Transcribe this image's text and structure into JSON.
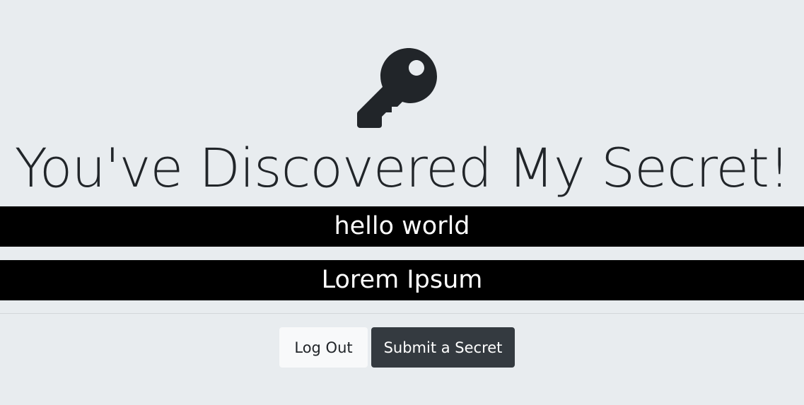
{
  "header": {
    "icon": "key-icon",
    "title": "You've Discovered My Secret!"
  },
  "secrets": [
    {
      "text": "hello world"
    },
    {
      "text": "Lorem Ipsum"
    }
  ],
  "actions": {
    "logout_label": "Log Out",
    "submit_label": "Submit a Secret"
  },
  "colors": {
    "background": "#e8ecef",
    "secret_bar": "#000000",
    "secret_text": "#ffffff",
    "button_light": "#f8f9fa",
    "button_dark": "#343a40",
    "text": "#212529"
  }
}
